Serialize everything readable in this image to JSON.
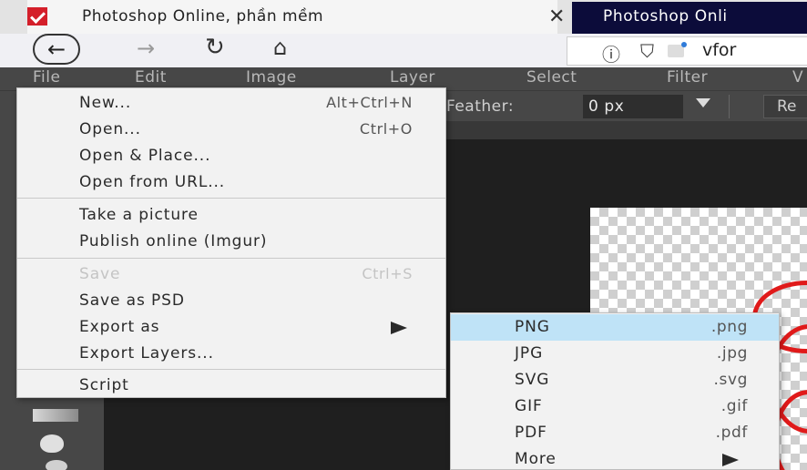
{
  "browser": {
    "active_tab_title": "Photoshop Online, phần mềm",
    "inactive_tab_title": "Photoshop Onli",
    "url_text": "vfor",
    "icons": {
      "back": "arrow-left-icon",
      "forward": "arrow-right-icon",
      "reload": "reload-icon",
      "home": "home-icon",
      "info": "info-icon",
      "shield": "shield-icon",
      "close": "close-icon",
      "favicon": "photopea-favicon-icon"
    }
  },
  "menubar": {
    "items": [
      "File",
      "Edit",
      "Image",
      "Layer",
      "Select",
      "Filter",
      "V"
    ]
  },
  "options": {
    "feather_label": "Feather:",
    "feather_value": "0  px",
    "refine_label": "Re"
  },
  "file_menu": {
    "items": [
      {
        "label": "New...",
        "shortcut": "Alt+Ctrl+N",
        "enabled": true
      },
      {
        "label": "Open...",
        "shortcut": "Ctrl+O",
        "enabled": true
      },
      {
        "label": "Open & Place...",
        "shortcut": "",
        "enabled": true
      },
      {
        "label": "Open from URL...",
        "shortcut": "",
        "enabled": true
      },
      {
        "label": "Take a picture",
        "shortcut": "",
        "enabled": true
      },
      {
        "label": "Publish online (Imgur)",
        "shortcut": "",
        "enabled": true
      },
      {
        "label": "Save",
        "shortcut": "Ctrl+S",
        "enabled": false
      },
      {
        "label": "Save as PSD",
        "shortcut": "",
        "enabled": true
      },
      {
        "label": "Export as",
        "shortcut": "",
        "enabled": true,
        "submenu": true
      },
      {
        "label": "Export Layers...",
        "shortcut": "",
        "enabled": true
      },
      {
        "label": "Script",
        "shortcut": "",
        "enabled": true
      }
    ]
  },
  "export_submenu": {
    "items": [
      {
        "label": "PNG",
        "ext": ".png",
        "highlighted": true
      },
      {
        "label": "JPG",
        "ext": ".jpg"
      },
      {
        "label": "SVG",
        "ext": ".svg"
      },
      {
        "label": "GIF",
        "ext": ".gif"
      },
      {
        "label": "PDF",
        "ext": ".pdf"
      },
      {
        "label": "More",
        "ext": "",
        "submenu": true
      }
    ]
  },
  "colors": {
    "menu_bg": "#f2f2f2",
    "highlight": "#bfe3f7",
    "app_bar": "#474747",
    "workspace": "#1f1f1f",
    "brand_red": "#d41f2a"
  }
}
